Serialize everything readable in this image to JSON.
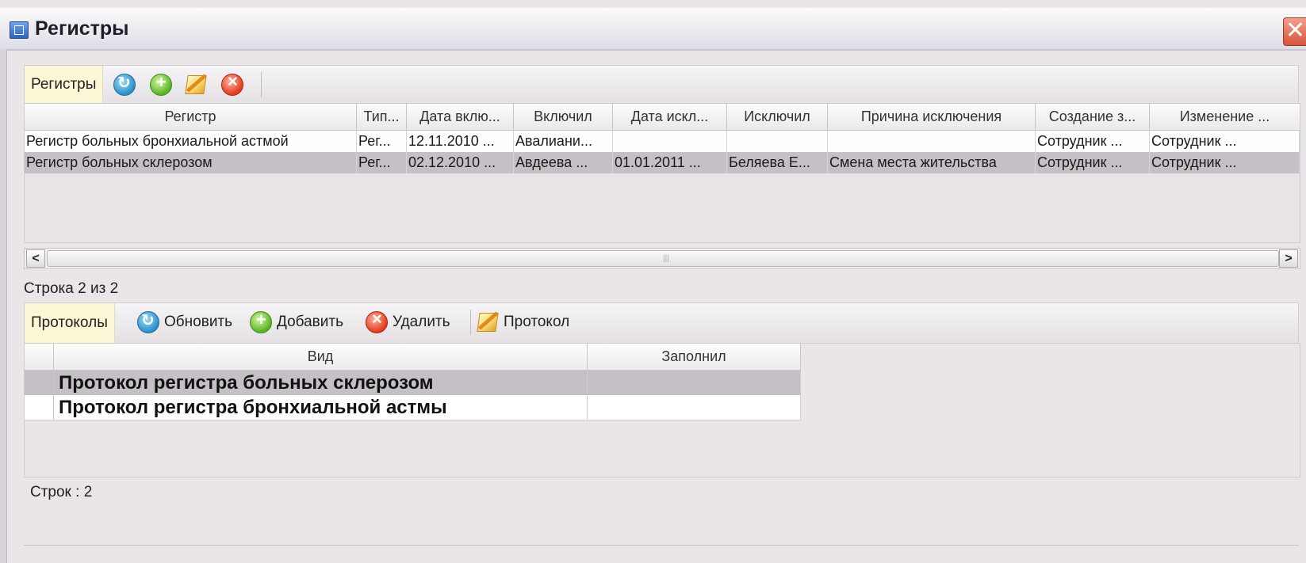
{
  "window": {
    "title": "Регистры",
    "close_glyph": "✕"
  },
  "registers_toolbar": {
    "label": "Регистры",
    "icons": [
      "refresh-icon",
      "add-icon",
      "edit-icon",
      "delete-icon"
    ]
  },
  "registers_table": {
    "columns": [
      "Регистр",
      "Тип...",
      "Дата вклю...",
      "Включил",
      "Дата искл...",
      "Исключил",
      "Причина исключения",
      "Создание з...",
      "Изменение ..."
    ],
    "rows": [
      [
        "Регистр больных бронхиальной астмой",
        "Рег...",
        "12.11.2010 ...",
        "Авалиани...",
        "",
        "",
        "",
        "Сотрудник ...",
        "Сотрудник ..."
      ],
      [
        "Регистр больных склерозом",
        "Рег...",
        "02.12.2010 ...",
        "Авдеева ...",
        "01.01.2011 ...",
        "Беляева Е...",
        "Смена места жительства",
        "Сотрудник ...",
        "Сотрудник ..."
      ]
    ],
    "selected_row": 2
  },
  "scrollbar": {
    "left_glyph": "<",
    "right_glyph": ">",
    "grip": "|||"
  },
  "registers_status": "Строка 2 из 2",
  "protocols_toolbar": {
    "label": "Протоколы",
    "refresh_label": "Обновить",
    "add_label": "Добавить",
    "delete_label": "Удалить",
    "protocol_label": "Протокол"
  },
  "protocols_table": {
    "columns": [
      "Вид",
      "Заполнил"
    ],
    "rows": [
      [
        "Протокол регистра больных склерозом",
        ""
      ],
      [
        "Протокол регистра бронхиальной астмы",
        ""
      ]
    ],
    "selected_row": 1
  },
  "protocols_status": "Строк : 2",
  "colors": {
    "selected_row": "#c4c0c6",
    "tab_highlight": "#fbf7d6",
    "background": "#e9e5e9"
  }
}
